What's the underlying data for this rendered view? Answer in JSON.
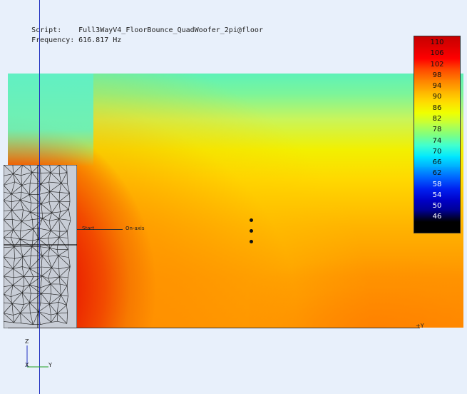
{
  "info": {
    "script_key": "Script:",
    "script_value": "Full3WayV4_FloorBounce_QuadWoofer_2pi@floor",
    "frequency_key": "Frequency:",
    "frequency_value": "616.817 Hz"
  },
  "legend": {
    "values": [
      "110",
      "106",
      "102",
      "98",
      "94",
      "90",
      "86",
      "82",
      "78",
      "74",
      "70",
      "66",
      "62",
      "58",
      "54",
      "50",
      "46",
      ""
    ],
    "colors": [
      "#c80000",
      "#e00000",
      "#ff0000",
      "#ff4800",
      "#ff8000",
      "#ffb000",
      "#ffdc00",
      "#f0ff00",
      "#bfff40",
      "#7fff80",
      "#40ffd0",
      "#00e8ff",
      "#00a8ff",
      "#0060ff",
      "#0020f0",
      "#0000c8",
      "#000090",
      "#000000"
    ]
  },
  "annotations": {
    "start_label": "Start",
    "onaxis_label": "On-axis",
    "y_axis_label": "+Y"
  },
  "triad": {
    "z_label": "Z",
    "x_label": "X",
    "y_label": "Y"
  }
}
